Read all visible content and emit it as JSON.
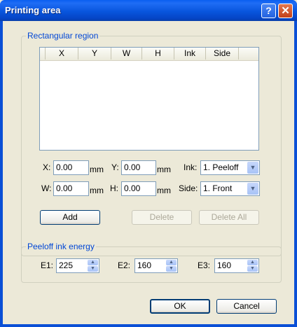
{
  "window": {
    "title": "Printing area",
    "help_glyph": "?",
    "close_glyph": "✕"
  },
  "region": {
    "label": "Rectangular region",
    "columns": [
      "X",
      "Y",
      "W",
      "H",
      "Ink",
      "Side"
    ],
    "rows": []
  },
  "form": {
    "x_label": "X:",
    "x_value": "0.00",
    "y_label": "Y:",
    "y_value": "0.00",
    "w_label": "W:",
    "w_value": "0.00",
    "h_label": "H:",
    "h_value": "0.00",
    "unit": "mm",
    "ink_label": "Ink:",
    "ink_value": "1. Peeloff",
    "side_label": "Side:",
    "side_value": "1. Front"
  },
  "actions": {
    "add": "Add",
    "delete": "Delete",
    "delete_all": "Delete All"
  },
  "energy": {
    "label": "Peeloff ink energy",
    "e1_label": "E1:",
    "e1_value": "225",
    "e2_label": "E2:",
    "e2_value": "160",
    "e3_label": "E3:",
    "e3_value": "160"
  },
  "footer": {
    "ok": "OK",
    "cancel": "Cancel"
  }
}
